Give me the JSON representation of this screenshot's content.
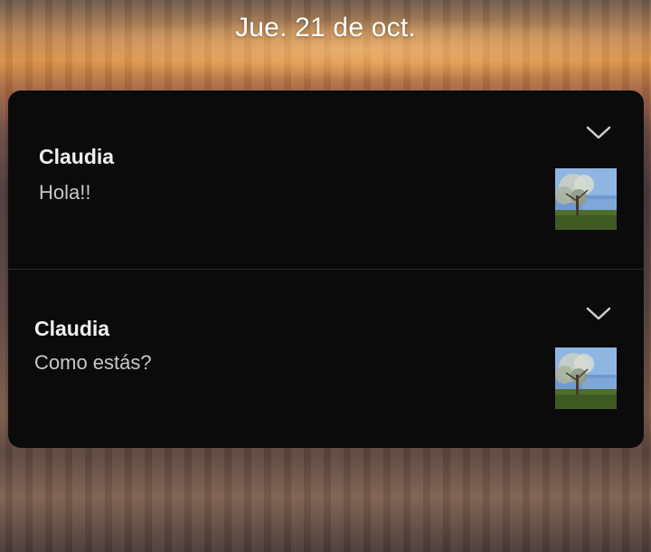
{
  "lockscreen": {
    "date": "Jue. 21 de oct."
  },
  "notifications": [
    {
      "sender": "Claudia",
      "message": "Hola!!",
      "expand_icon": "chevron-down-icon",
      "thumbnail": "tree-photo-thumbnail"
    },
    {
      "sender": "Claudia",
      "message": "Como estás?",
      "expand_icon": "chevron-down-icon",
      "thumbnail": "tree-photo-thumbnail"
    }
  ],
  "colors": {
    "panel_background": "#0b0b0c",
    "sender_text": "#f1f1f1",
    "message_text": "#c8c8c8",
    "date_text": "#ffffff"
  }
}
